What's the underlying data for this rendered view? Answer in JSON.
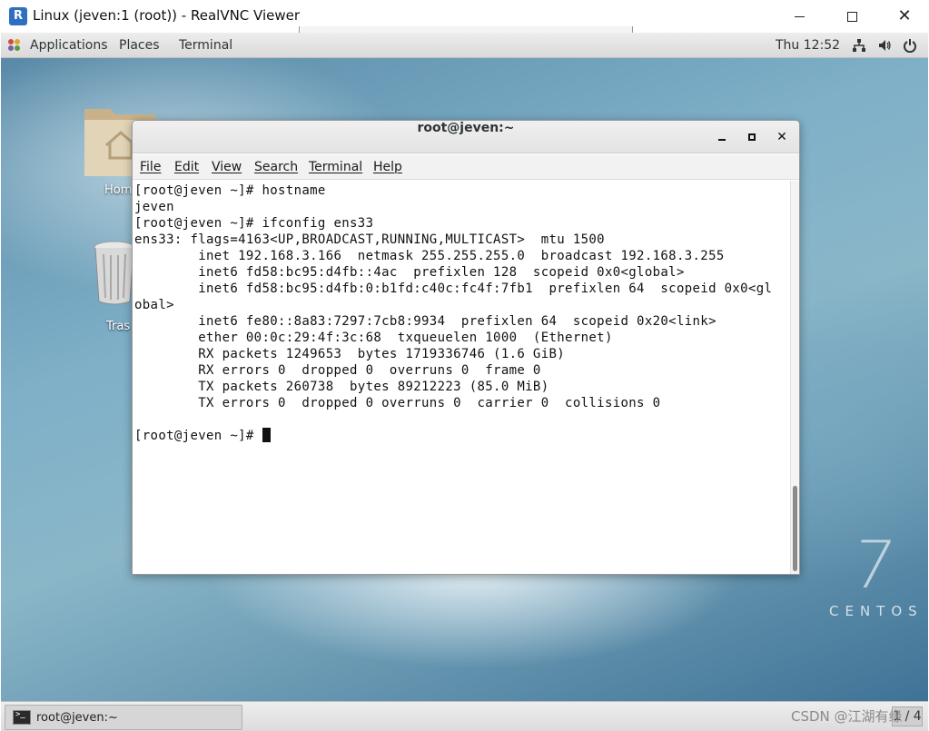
{
  "vnc_window": {
    "title": "Linux (jeven:1 (root)) - RealVNC Viewer",
    "logo_text": "R"
  },
  "top_panel": {
    "applications": "Applications",
    "places": "Places",
    "terminal": "Terminal",
    "clock": "Thu 12:52"
  },
  "desktop": {
    "home_label": "Hom",
    "trash_label": "Tras",
    "branding_number": "7",
    "branding_word": "CENTOS"
  },
  "terminal_window": {
    "title": "root@jeven:~",
    "menu": {
      "file": "File",
      "edit": "Edit",
      "view": "View",
      "search": "Search",
      "terminal": "Terminal",
      "help": "Help"
    },
    "lines": [
      "[root@jeven ~]# hostname",
      "jeven",
      "[root@jeven ~]# ifconfig ens33",
      "ens33: flags=4163<UP,BROADCAST,RUNNING,MULTICAST>  mtu 1500",
      "        inet 192.168.3.166  netmask 255.255.255.0  broadcast 192.168.3.255",
      "        inet6 fd58:bc95:d4fb::4ac  prefixlen 128  scopeid 0x0<global>",
      "        inet6 fd58:bc95:d4fb:0:b1fd:c40c:fc4f:7fb1  prefixlen 64  scopeid 0x0<gl",
      "obal>",
      "        inet6 fe80::8a83:7297:7cb8:9934  prefixlen 64  scopeid 0x20<link>",
      "        ether 00:0c:29:4f:3c:68  txqueuelen 1000  (Ethernet)",
      "        RX packets 1249653  bytes 1719336746 (1.6 GiB)",
      "        RX errors 0  dropped 0  overruns 0  frame 0",
      "        TX packets 260738  bytes 89212223 (85.0 MiB)",
      "        TX errors 0  dropped 0 overruns 0  carrier 0  collisions 0",
      ""
    ],
    "prompt": "[root@jeven ~]# "
  },
  "taskbar": {
    "terminal_task_label": "root@jeven:~",
    "watermark": "CSDN @江湖有缘",
    "workspace": "1 / 4"
  },
  "icons": {
    "vnc_logo": "realvnc-logo-icon",
    "apps": "applications-icon",
    "network": "network-icon",
    "volume": "volume-icon",
    "power": "power-icon",
    "home_folder": "home-folder-icon",
    "trash": "trash-icon",
    "terminal_task": "terminal-icon"
  },
  "colors": {
    "desktop_accent": "#5a8aa8",
    "panel_bg": "#e4e4e4",
    "terminal_bg": "#ffffff",
    "terminal_fg": "#111111"
  }
}
